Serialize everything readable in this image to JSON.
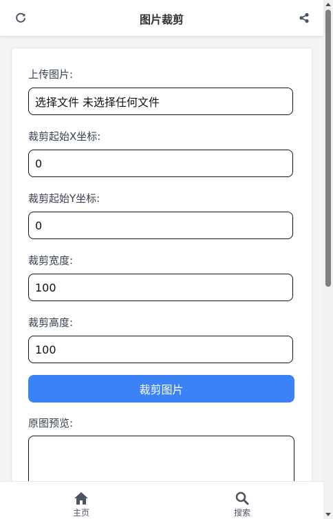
{
  "header": {
    "title": "图片裁剪",
    "refresh_icon": "refresh-icon",
    "share_icon": "share-icon"
  },
  "form": {
    "upload_label": "上传图片:",
    "file_button_text": "选择文件",
    "file_status_text": "未选择任何文件",
    "x_label": "裁剪起始X坐标:",
    "x_value": "0",
    "y_label": "裁剪起始Y坐标:",
    "y_value": "0",
    "width_label": "裁剪宽度:",
    "width_value": "100",
    "height_label": "裁剪高度:",
    "height_value": "100",
    "crop_button_label": "裁剪图片",
    "preview_label": "原图预览:"
  },
  "nav": {
    "home_label": "主页",
    "search_label": "搜索"
  },
  "colors": {
    "accent": "#3b82f6",
    "text": "#333333",
    "icon": "#4b5563"
  }
}
